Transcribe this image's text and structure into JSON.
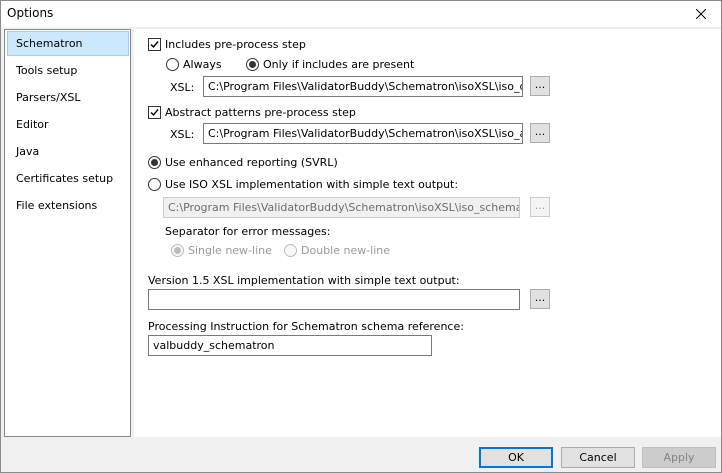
{
  "window": {
    "title": "Options"
  },
  "sidebar": {
    "items": [
      {
        "label": "Schematron",
        "selected": true
      },
      {
        "label": "Tools setup"
      },
      {
        "label": "Parsers/XSL"
      },
      {
        "label": "Editor"
      },
      {
        "label": "Java"
      },
      {
        "label": "Certificates setup"
      },
      {
        "label": "File extensions"
      }
    ]
  },
  "schematron": {
    "includes": {
      "label": "Includes pre-process step",
      "checked": true,
      "always_label": "Always",
      "only_if_label": "Only if includes are present",
      "selected": "only_if",
      "xsl_label": "XSL:",
      "xsl_value": "C:\\Program Files\\ValidatorBuddy\\Schematron\\isoXSL\\iso_dsdl_include.xsl",
      "browse_label": "..."
    },
    "abstract": {
      "label": "Abstract patterns pre-process step",
      "checked": true,
      "xsl_label": "XSL:",
      "xsl_value": "C:\\Program Files\\ValidatorBuddy\\Schematron\\isoXSL\\iso_abstract_expand.xsl",
      "browse_label": "..."
    },
    "reporting": {
      "enhanced_label": "Use enhanced reporting (SVRL)",
      "iso_label": "Use ISO XSL implementation with simple text output:",
      "selected": "enhanced",
      "iso_xsl_value": "C:\\Program Files\\ValidatorBuddy\\Schematron\\isoXSL\\iso_schematron_skeleton.xsl",
      "browse_label": "...",
      "separator_label": "Separator for error messages:",
      "single_label": "Single new-line",
      "double_label": "Double new-line",
      "separator_selected": "single"
    },
    "v15": {
      "label": "Version 1.5 XSL implementation with simple text output:",
      "value": "",
      "browse_label": "..."
    },
    "pi": {
      "label": "Processing Instruction for Schematron schema reference:",
      "value": "valbuddy_schematron"
    }
  },
  "footer": {
    "ok_label": "OK",
    "cancel_label": "Cancel",
    "apply_label": "Apply"
  },
  "colors": {
    "selection_bg": "#cce8ff",
    "selection_border": "#99d1ff",
    "default_button_border": "#0078d7"
  }
}
